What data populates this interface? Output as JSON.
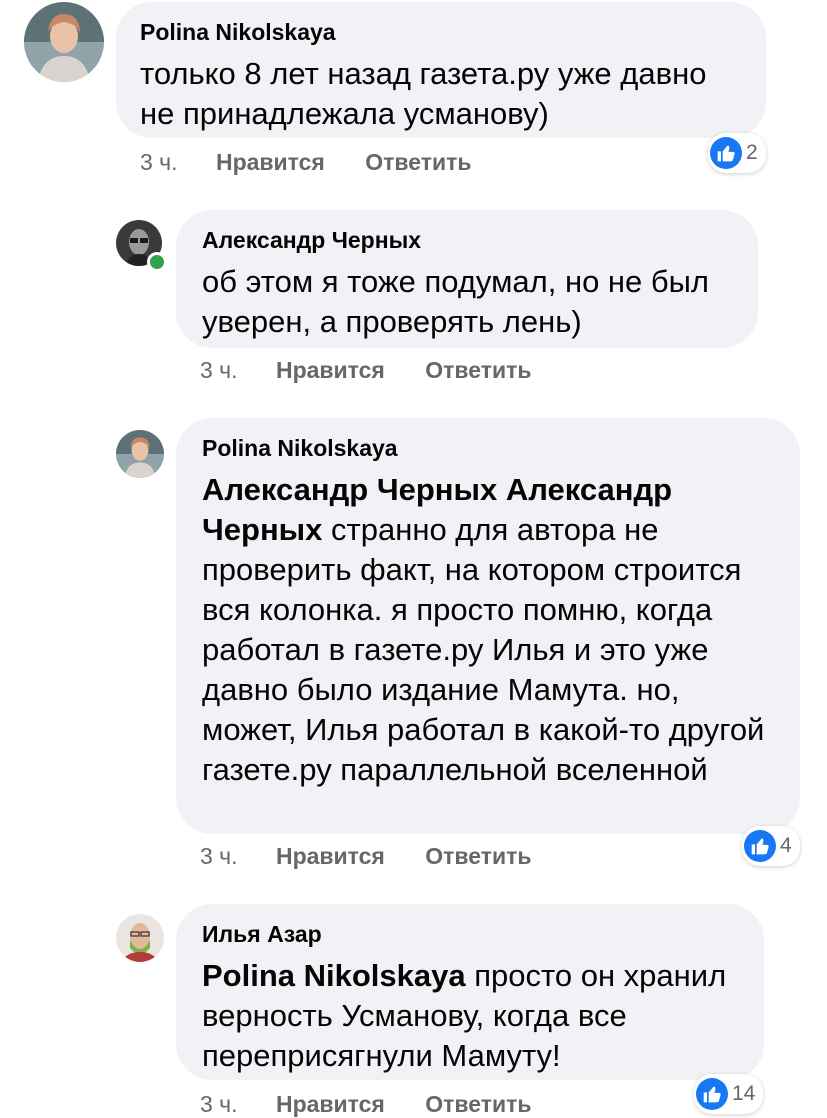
{
  "accent_color": "#1877f2",
  "bubble_color": "#f0f2f5",
  "meta_color": "#65676b",
  "comments": [
    {
      "author": "Polina Nikolskaya",
      "mention": "",
      "text": "только 8 лет назад газета.ру уже давно не принадлежала усманову)",
      "time": "3 ч.",
      "like_label": "Нравится",
      "reply_label": "Ответить",
      "reactions": "2",
      "reaction_icon": "like-icon"
    },
    {
      "author": "Александр Черных",
      "mention": "",
      "text": "об этом я тоже подумал, но не был уверен, а проверять лень)",
      "time": "3 ч.",
      "like_label": "Нравится",
      "reply_label": "Ответить",
      "online": true
    },
    {
      "author": "Polina Nikolskaya",
      "mention": "Александр Черных Александр Черных",
      "text": " странно для автора не проверить факт, на котором строится вся колонка. я просто помню, когда работал в газете.ру Илья и это уже давно было издание Мамута. но, может, Илья работал в какой-то другой газете.ру параллельной вселенной",
      "time": "3 ч.",
      "like_label": "Нравится",
      "reply_label": "Ответить",
      "reactions": "4",
      "reaction_icon": "like-icon"
    },
    {
      "author": "Илья Азар",
      "mention": "Polina Nikolskaya",
      "text": " просто он хранил верность Усманову, когда все переприсягнули Мамуту!",
      "time": "3 ч.",
      "like_label": "Нравится",
      "reply_label": "Ответить",
      "reactions": "14",
      "reaction_icon": "like-icon"
    }
  ]
}
